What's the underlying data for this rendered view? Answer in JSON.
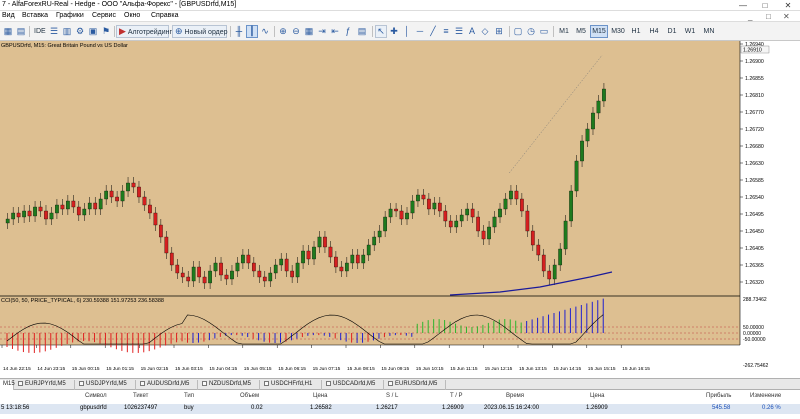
{
  "window": {
    "title": "7 - AlfaForexRU-Real - Hedge - ООО \"Альфа-Форекс\" - [GBPUSDrfd,M15]",
    "minimize": "—",
    "maximize": "□",
    "close": "✕"
  },
  "menu": {
    "items": [
      "Вид",
      "Вставка",
      "Графики",
      "Сервис",
      "Окно",
      "Справка"
    ],
    "doc_controls": [
      "_",
      "□",
      "✕"
    ]
  },
  "toolbar": {
    "ide_label": "IDE",
    "algo_label": "Алготрейдинг",
    "new_order_label": "Новый ордер",
    "timeframes": [
      "M1",
      "M5",
      "M15",
      "M30",
      "H1",
      "H4",
      "D1",
      "W1",
      "MN"
    ],
    "active_timeframe": "M15"
  },
  "chart": {
    "label": "GBPUSDrfd, M15:  Great Britain Pound vs US Dollar",
    "indicator_label": "CCI(50, 50, PRICE_TYPICAL, 6) 230.59388 151.97253 236.58388",
    "bg_color": "#ddbf91",
    "bull_color": "#1e7a1e",
    "bear_color": "#d42020",
    "ma_color": "#1a1a9a",
    "price_ticks": [
      "1.26940",
      "1.26900",
      "1.26855",
      "1.26810",
      "1.26770",
      "1.26720",
      "1.26680",
      "1.26630",
      "1.26585",
      "1.26540",
      "1.26495",
      "1.26450",
      "1.26405",
      "1.26365",
      "1.26320"
    ],
    "current_price": "1.26910",
    "ind_ticks": [
      "288.73462",
      "50.00000",
      "0.00000",
      "-50.00000",
      "-262.75462"
    ],
    "time_ticks": [
      "14 Jun 22:15",
      "14 Jun 23:15",
      "15 Jun 00:15",
      "15 Jun 01:15",
      "15 Jun 02:15",
      "15 Jun 03:15",
      "15 Jun 04:15",
      "15 Jun 05:15",
      "15 Jun 06:15",
      "15 Jun 07:15",
      "15 Jun 08:15",
      "15 Jun 09:15",
      "15 Jun 10:15",
      "15 Jun 11:15",
      "15 Jun 12:15",
      "15 Jun 13:15",
      "15 Jun 14:15",
      "15 Jun 15:15",
      "15 Jun 16:15"
    ]
  },
  "chart_tabs": [
    {
      "label": "M15",
      "active": true
    },
    {
      "label": "EURJPYrfd,M5",
      "active": false
    },
    {
      "label": "USDJPYrfd,M5",
      "active": false
    },
    {
      "label": "AUDUSDrfd,M5",
      "active": false
    },
    {
      "label": "NZDUSDrfd,M5",
      "active": false
    },
    {
      "label": "USDCHFrfd,H1",
      "active": false
    },
    {
      "label": "USDCADrfd,M5",
      "active": false
    },
    {
      "label": "EURUSDrfd,M5",
      "active": false
    }
  ],
  "trade_table": {
    "headers": [
      "Символ",
      "Тикет",
      "Тип",
      "Объем",
      "Цена",
      "S / L",
      "T / P",
      "Время",
      "Цена",
      "Прибыль",
      "Изменение"
    ],
    "row": {
      "time_open": "5 13:18:56",
      "symbol": "gbpusdrfd",
      "ticket": "1026237497",
      "type": "buy",
      "volume": "0.02",
      "price": "1.26582",
      "sl": "1.26217",
      "tp": "1.26909",
      "time": "2023.06.15 16:24:00",
      "current": "1.26909",
      "profit": "545.58",
      "change": "0.26 %"
    }
  }
}
